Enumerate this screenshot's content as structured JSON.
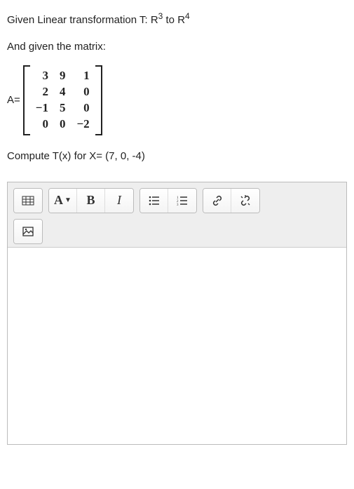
{
  "question": {
    "line1_prefix": "Given Linear transformation T: R",
    "line1_sup1": "3",
    "line1_mid": " to R",
    "line1_sup2": "4",
    "line2": "And given the matrix:",
    "matrix_label": "A=",
    "matrix_rows": [
      [
        "3",
        "9",
        "1"
      ],
      [
        "2",
        "4",
        "0"
      ],
      [
        "−1",
        "5",
        "0"
      ],
      [
        "0",
        "0",
        "−2"
      ]
    ],
    "line3": "Compute T(x) for X= (7, 0, -4)"
  },
  "toolbar": {
    "source_icon": "source-grid-icon",
    "font_label": "A",
    "bold_label": "B",
    "italic_label": "I",
    "ul_icon": "unordered-list-icon",
    "ol_icon": "ordered-list-icon",
    "link_icon": "link-icon",
    "unlink_icon": "unlink-icon",
    "image_icon": "image-icon"
  },
  "editor": {
    "content": ""
  }
}
